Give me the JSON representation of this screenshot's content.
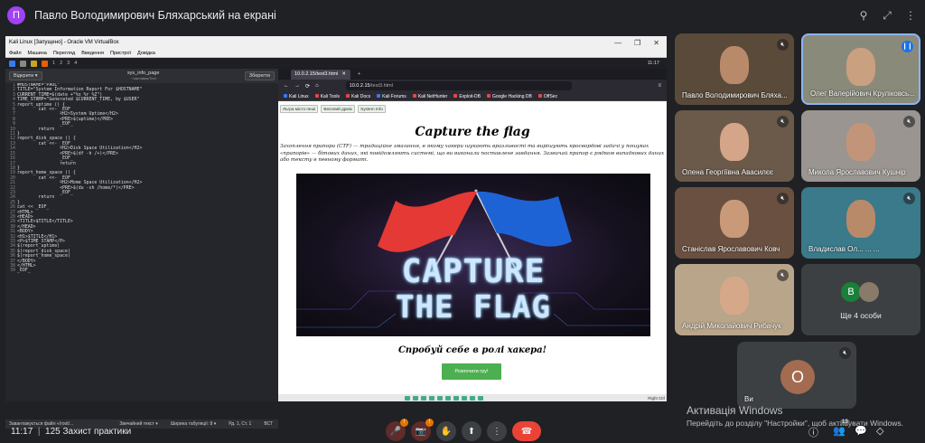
{
  "header": {
    "avatar_letter": "П",
    "title": "Павло Володимирович Бляхарський на екрані",
    "pin": "⚲",
    "fit": "⤢",
    "more": "⋮"
  },
  "vbox": {
    "title": "Kali Linux [Запущено] - Oracle VM VirtualBox",
    "window_controls": [
      "—",
      "❐",
      "✕"
    ],
    "menu": [
      "Файл",
      "Машина",
      "Перегляд",
      "Введення",
      "Пристрої",
      "Довідка"
    ],
    "workspaces": [
      "1",
      "2",
      "3",
      "4"
    ],
    "clock": "11:17",
    "status_right": "Right Ctrl"
  },
  "editor": {
    "open_label": "Відкрити ▾",
    "save_label": "Зберегти",
    "file_name": "sys_info_page",
    "file_path": "~/заставки/Text",
    "status_left": "Завантажується файл «/root/...",
    "status_items": [
      "Звичайний текст ▾",
      "Ширина табуляції: 8 ▾",
      "Рд. 1, Ст. 1",
      "ВСТ"
    ],
    "lines": [
      "#HOSTNAME=\"PAUL\"",
      "TITLE=\"System Information Report For $HOSTNAME\"",
      "CURRENT_TIME=$(date +\"%x %r %Z\")",
      "TIME_STAMP=\"Generated $CURRENT_TIME, by $USER\"",
      "report_uptime () {",
      "        cat <<- _EOF_",
      "                <H2>System Uptime</H2>",
      "                <PRE>$(uptime)</PRE>",
      "                _EOF_",
      "        return",
      "}",
      "report_disk_space () {",
      "        cat <<- _EOF_",
      "                <H2>Disk Space Utilization</H2>",
      "                <PRE>$(df -h /+)</PRE>",
      "                _EOF_",
      "                return",
      "}",
      "report_home_space () {",
      "        cat <<- _EOF_",
      "                <H2>Home Space Utilization</H2>",
      "                <PRE>$(du -sh /home/*)</PRE>",
      "                _EOF_",
      "        return",
      "}",
      "cat << _EOF_",
      "<HTML>",
      "<HEAD>",
      "<TITLE>$TITLE</TITLE>",
      "</HEAD>",
      "<BODY>",
      "<H1>$TITLE</H1>",
      "<P>$TIME_STAMP</P>",
      "$(report_uptime)",
      "$(report_disk_space)",
      "$(report_home_space)",
      "</BODY>",
      "</HTML>",
      "_EOF_"
    ]
  },
  "firefox": {
    "tab_title": "10.0.2.15/test3.html",
    "tab_close": "✕",
    "tab_new": "+",
    "nav": [
      "←",
      "→",
      "⟳",
      "⌂"
    ],
    "url_host": "10.0.2.15",
    "url_path": "/test3.html",
    "bookmarks": [
      "Kali Linux",
      "Kali Tools",
      "Kali Docs",
      "Kali Forums",
      "Kali NetHunter",
      "Exploit-DB",
      "Google Hacking DB",
      "OffSec"
    ],
    "page": {
      "buttons": [
        "Льгра місто пеші",
        "Весняий дрміє",
        "System Info"
      ],
      "title": "Capture the flag",
      "intro": "Захоплення прапора (CTF) — традиційне змагання, в якому хакери шукають вразливості та вирішують кросвордові задачі у пошуках «прапорів» — бітових даних, які повідомляють системі, що ви виконали поставлене завдання. Зазвичай прапор є рядком випадкових даних або тексту в певному форматі.",
      "banner_line1": "CAPTURE",
      "banner_line2": "THE FLAG",
      "subtitle": "Спробуй себе в ролі хакера!",
      "start_button": "Розпочати гру!"
    }
  },
  "participants": [
    {
      "name": "Павло Володимирович Бляха...",
      "bg": "#5a4a3a",
      "face": "#b98a6a",
      "mic": "muted"
    },
    {
      "name": "Олег Валерійович Круліковсь...",
      "bg": "#8a8a7a",
      "face": "#c9a080",
      "mic": "speaking"
    },
    {
      "name": "Олена Георгіївна Авасилєє",
      "bg": "#6b5a4a",
      "face": "#d4a588",
      "mic": "muted"
    },
    {
      "name": "Микола Ярославович Кушнір",
      "bg": "#9a9590",
      "face": "#c2957a",
      "mic": "muted"
    },
    {
      "name": "Станіслав Ярославович Ковч",
      "bg": "#6a5040",
      "face": "#c99a7a",
      "mic": "muted"
    },
    {
      "name": "Владислав Ол... ... ...",
      "bg": "#3a7a8a",
      "face": "#b88a6a",
      "mic": "muted"
    },
    {
      "name": "Андрій Миколайович Рибачук",
      "bg": "#b8a58a",
      "face": "#d4a888",
      "mic": "muted"
    }
  ],
  "others": {
    "avatar_letter": "В",
    "label": "Ще 4 особи"
  },
  "self": {
    "avatar_letter": "О",
    "name": "Ви"
  },
  "watermark": {
    "line1": "Активація Windows",
    "line2": "Перейдіть до розділу \"Настройки\", щоб активувати Windows."
  },
  "bottom": {
    "time": "11:17",
    "separator": "|",
    "meeting": "125 Захист практики",
    "mic_icon": "🎤",
    "cam_icon": "📷",
    "hand_icon": "✋",
    "present_icon": "⬆",
    "more_icon": "⋮",
    "end_icon": "☎",
    "badge": "!",
    "info_icon": "ⓘ",
    "people_icon": "👥",
    "people_count": "13",
    "chat_icon": "💬",
    "shapes_icon": "◇"
  },
  "colors": {
    "accent": "#1a73e8",
    "end_call": "#ea4335",
    "start_btn": "#4caf50",
    "kali_blue": "#367bf0"
  }
}
